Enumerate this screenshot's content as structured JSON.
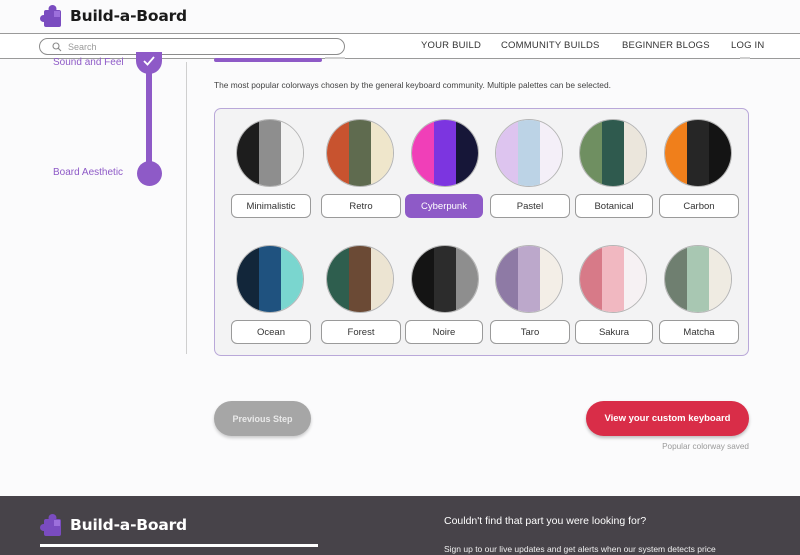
{
  "header": {
    "brand": "Build-a-Board",
    "search_placeholder": "Search",
    "nav": [
      "YOUR BUILD",
      "COMMUNITY BUILDS",
      "BEGINNER BLOGS",
      "LOG IN"
    ]
  },
  "stepper": {
    "steps": [
      {
        "label": "Sound and Feel",
        "state": "completed"
      },
      {
        "label": "Board Aesthetic",
        "state": "current"
      }
    ]
  },
  "section": {
    "description": "The most popular colorways chosen by the general keyboard community. Multiple palettes can be selected."
  },
  "palettes": [
    {
      "name": "Minimalistic",
      "colors": [
        "#1d1d1d",
        "#8e8e8e",
        "#f2f2f2"
      ],
      "selected": false
    },
    {
      "name": "Retro",
      "colors": [
        "#c8532f",
        "#5f6b4f",
        "#efe6cb"
      ],
      "selected": false
    },
    {
      "name": "Cyberpunk",
      "colors": [
        "#f03fb8",
        "#7c35e0",
        "#161638"
      ],
      "selected": true
    },
    {
      "name": "Pastel",
      "colors": [
        "#ddc4ef",
        "#bcd3e6",
        "#f4eff8"
      ],
      "selected": false
    },
    {
      "name": "Botanical",
      "colors": [
        "#6f8f61",
        "#2f5a4e",
        "#ebe6dc"
      ],
      "selected": false
    },
    {
      "name": "Carbon",
      "colors": [
        "#f07f1b",
        "#262626",
        "#141414"
      ],
      "selected": false
    },
    {
      "name": "Ocean",
      "colors": [
        "#12263a",
        "#1f527f",
        "#7ad6cf"
      ],
      "selected": false
    },
    {
      "name": "Forest",
      "colors": [
        "#2e5e4e",
        "#6b4a35",
        "#ece4d2"
      ],
      "selected": false
    },
    {
      "name": "Noire",
      "colors": [
        "#141414",
        "#2c2c2c",
        "#8e8e8e"
      ],
      "selected": false
    },
    {
      "name": "Taro",
      "colors": [
        "#8e7aa5",
        "#bca8cb",
        "#f3eee7"
      ],
      "selected": false
    },
    {
      "name": "Sakura",
      "colors": [
        "#d77a88",
        "#f1b8c1",
        "#f6f1f3"
      ],
      "selected": false
    },
    {
      "name": "Matcha",
      "colors": [
        "#6f7f70",
        "#a8c7b2",
        "#efebe2"
      ],
      "selected": false
    }
  ],
  "actions": {
    "previous": "Previous Step",
    "view": "View your custom keyboard",
    "saved_note": "Popular colorway saved"
  },
  "footer": {
    "brand": "Build-a-Board",
    "heading": "Couldn't find that part you were looking for?",
    "subtext": "Sign up to our live updates and get alerts when our system detects price"
  },
  "colors": {
    "accent": "#8e5ac7",
    "cta": "#d92d48",
    "footer_bg": "#474349"
  }
}
